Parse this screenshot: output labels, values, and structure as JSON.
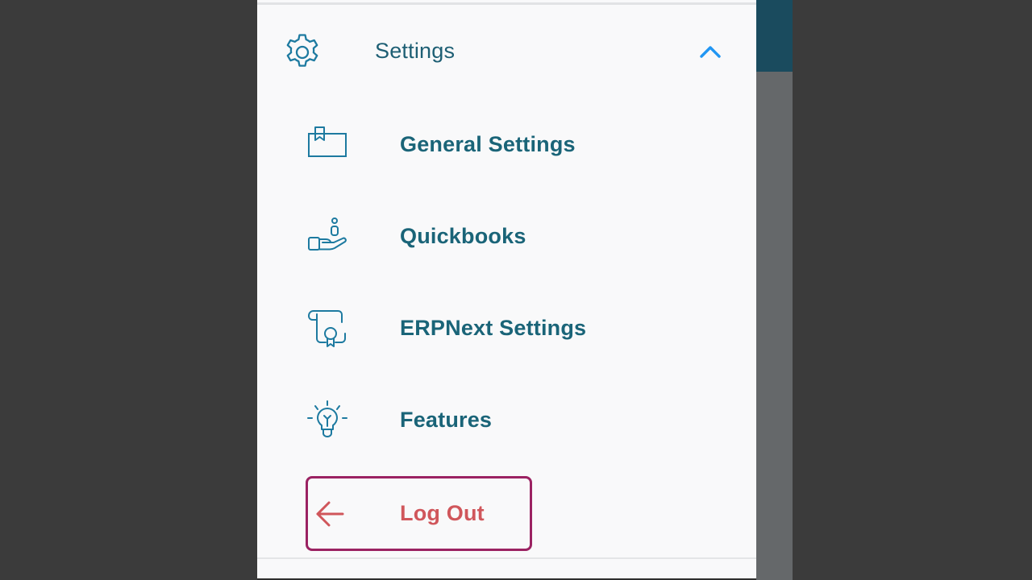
{
  "colors": {
    "backdrop": "#3b3b3b",
    "drawer_bg": "#f9f9fa",
    "primary_text": "#1a6478",
    "icon_stroke": "#1d7aa0",
    "chevron": "#2196f3",
    "logout_text": "#d0565b",
    "logout_border": "#9b2262",
    "app_header": "#1a4b5e"
  },
  "drawer": {
    "section": {
      "label": "Settings",
      "icon": "gear-icon",
      "expanded": true,
      "toggle_icon": "chevron-up-icon"
    },
    "items": [
      {
        "label": "General Settings",
        "icon": "folder-icon"
      },
      {
        "label": "Quickbooks",
        "icon": "hand-coin-icon"
      },
      {
        "label": "ERPNext Settings",
        "icon": "certificate-scroll-icon"
      },
      {
        "label": "Features",
        "icon": "lightbulb-icon"
      }
    ],
    "logout": {
      "label": "Log Out",
      "icon": "arrow-left-icon"
    }
  }
}
